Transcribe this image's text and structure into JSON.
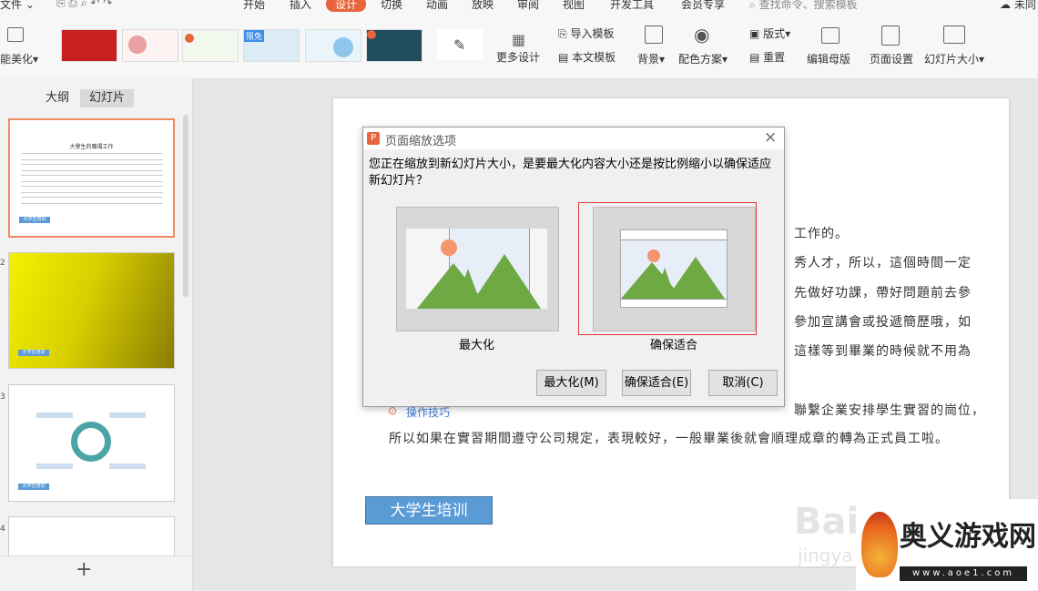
{
  "menu": {
    "file": "文件",
    "items": [
      "开始",
      "插入",
      "设计",
      "切换",
      "动画",
      "放映",
      "审阅",
      "视图",
      "开发工具",
      "会员专享"
    ],
    "search_placeholder": "查找命令、搜索模板",
    "right": "未同"
  },
  "ribbon": {
    "smart_beautify": "能美化",
    "badge_free": "限免",
    "more_design": "更多设计",
    "import_template": "导入模板",
    "this_template": "本文模板",
    "background": "背景",
    "color_scheme": "配色方案",
    "layout": "版式",
    "reset": "重置",
    "edit_master": "编辑母版",
    "page_setup": "页面设置",
    "slide_size": "幻灯片大小"
  },
  "sidebar": {
    "tab_outline": "大纲",
    "tab_slides": "幻灯片",
    "slide1_title": "大學生的職場工作",
    "slide1_btn": "大学生培训",
    "slide2_btn": "大学生培训",
    "slide3_btn": "大学生培训",
    "num2": "2",
    "num3": "3",
    "num4": "4",
    "add": "+"
  },
  "slide": {
    "lines": [
      "工作的。",
      "秀人才，所以，這個時間一定",
      "先做好功課，帶好問題前去參",
      "參加宣講會或投遞簡歷哦，如",
      "這樣等到畢業的時候就不用為",
      "聯繫企業安排學生實習的崗位，",
      "所以如果在實習期間遵守公司規定，表現較好，一般畢業後就會順理成章的轉為正式員工啦。"
    ],
    "button": "大学生培训",
    "tip": "操作技巧"
  },
  "dialog": {
    "title": "页面缩放选项",
    "message": "您正在缩放到新幻灯片大小，是要最大化内容大小还是按比例缩小以确保适应新幻灯片？",
    "option1": "最大化",
    "option2": "确保适合",
    "btn_max": "最大化(M)",
    "btn_fit": "确保适合(E)",
    "btn_cancel": "取消(C)",
    "close": "×"
  },
  "watermark": {
    "logo_text": "奥义游戏网",
    "url": "www.aoe1.com",
    "baidu": "Bai",
    "jingyan": "jingya"
  },
  "colors": {
    "accent": "#e8643c",
    "slide_button": "#5b9bd5",
    "selected_option_border": "#e03a3a",
    "mountain": "#6ea944",
    "sun": "#f4956b"
  }
}
